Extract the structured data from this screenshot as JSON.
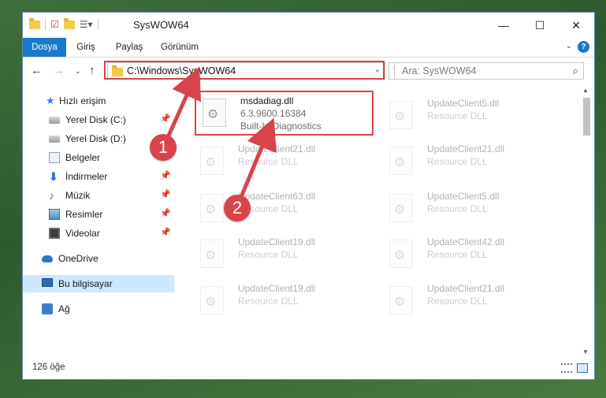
{
  "window": {
    "title": "SysWOW64"
  },
  "ribbon": {
    "tabs": [
      "Dosya",
      "Giriş",
      "Paylaş",
      "Görünüm"
    ],
    "help_label": "?"
  },
  "address": {
    "path": "C:\\Windows\\SysWOW64"
  },
  "search": {
    "placeholder": "Ara: SysWOW64"
  },
  "sidebar": {
    "items": [
      {
        "label": "Hızlı erişim",
        "icon": "star-icon"
      },
      {
        "label": "Yerel Disk (C:)",
        "icon": "drive-icon",
        "pinned": true
      },
      {
        "label": "Yerel Disk (D:)",
        "icon": "drive-icon",
        "pinned": false
      },
      {
        "label": "Belgeler",
        "icon": "documents-icon",
        "pinned": false
      },
      {
        "label": "İndirmeler",
        "icon": "downloads-icon",
        "pinned": true
      },
      {
        "label": "Müzik",
        "icon": "music-icon",
        "pinned": true
      },
      {
        "label": "Resimler",
        "icon": "pictures-icon",
        "pinned": true
      },
      {
        "label": "Videolar",
        "icon": "videos-icon",
        "pinned": true
      },
      {
        "label": "OneDrive",
        "icon": "onedrive-icon"
      },
      {
        "label": "Bu bilgisayar",
        "icon": "pc-icon",
        "selected": true
      },
      {
        "label": "Ağ",
        "icon": "network-icon"
      }
    ]
  },
  "files": [
    {
      "name": "msdadiag.dll",
      "line2": "6.3.9600.16384",
      "line3": "Built-In Diagnostics",
      "highlighted": true
    },
    {
      "name": "UpdateClient5.dll",
      "line2": "Resource DLL"
    },
    {
      "name": "UpdateClient21.dll",
      "line2": "Resource DLL"
    },
    {
      "name": "UpdateClient21.dll",
      "line2": "Resource DLL"
    },
    {
      "name": "UpdateClient63.dll",
      "line2": "Resource DLL"
    },
    {
      "name": "UpdateClient5.dll",
      "line2": "Resource DLL"
    },
    {
      "name": "UpdateClient19.dll",
      "line2": "Resource DLL"
    },
    {
      "name": "UpdateClient42.dll",
      "line2": "Resource DLL"
    },
    {
      "name": "UpdateClient19.dll",
      "line2": "Resource DLL"
    },
    {
      "name": "UpdateClient21.dll",
      "line2": "Resource DLL"
    }
  ],
  "status": {
    "item_count": "126 öğe"
  },
  "callouts": [
    "1",
    "2"
  ],
  "colors": {
    "accent": "#1979ca",
    "highlight": "#d9434a",
    "selection": "#cce8ff"
  }
}
